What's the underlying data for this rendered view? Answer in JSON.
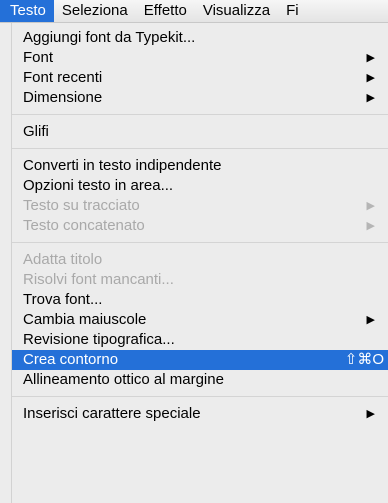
{
  "menubar": {
    "items": [
      "Testo",
      "Seleziona",
      "Effetto",
      "Visualizza",
      "Fi"
    ]
  },
  "menu": {
    "groups": [
      [
        {
          "label": "Aggiungi font da Typekit...",
          "enabled": true
        },
        {
          "label": "Font",
          "enabled": true,
          "submenu": true
        },
        {
          "label": "Font recenti",
          "enabled": true,
          "submenu": true
        },
        {
          "label": "Dimensione",
          "enabled": true,
          "submenu": true
        }
      ],
      [
        {
          "label": "Glifi",
          "enabled": true
        }
      ],
      [
        {
          "label": "Converti in testo indipendente",
          "enabled": true
        },
        {
          "label": "Opzioni testo in area...",
          "enabled": true
        },
        {
          "label": "Testo su tracciato",
          "enabled": false,
          "submenu": true
        },
        {
          "label": "Testo concatenato",
          "enabled": false,
          "submenu": true
        }
      ],
      [
        {
          "label": "Adatta titolo",
          "enabled": false
        },
        {
          "label": "Risolvi font mancanti...",
          "enabled": false
        },
        {
          "label": "Trova font...",
          "enabled": true
        },
        {
          "label": "Cambia maiuscole",
          "enabled": true,
          "submenu": true
        },
        {
          "label": "Revisione tipografica...",
          "enabled": true
        },
        {
          "label": "Crea contorno",
          "enabled": true,
          "selected": true,
          "shortcut": "⇧⌘O"
        },
        {
          "label": "Allineamento ottico al margine",
          "enabled": true
        }
      ],
      [
        {
          "label": "Inserisci carattere speciale",
          "enabled": true,
          "submenu": true
        }
      ]
    ],
    "arrow_glyph": "▶"
  },
  "colors": {
    "selection": "#2470d8",
    "menu_background": "#ececec",
    "disabled_text": "#a9a9a9"
  }
}
